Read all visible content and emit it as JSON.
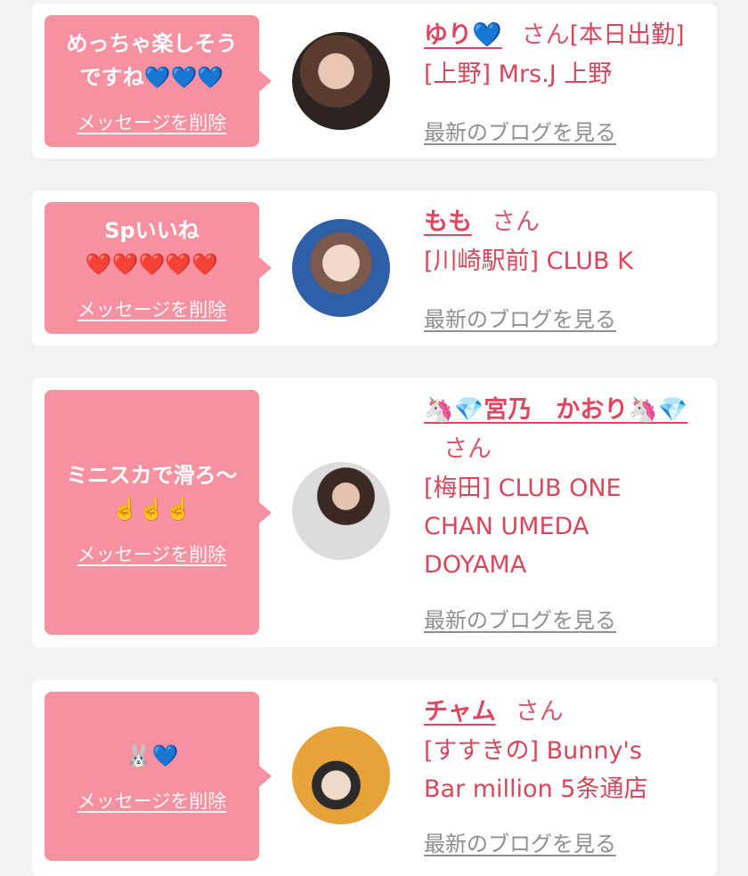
{
  "cards": [
    {
      "message": "めっちゃ楽しそう\nですね💙💙💙",
      "delete_label": "メッセージを削除",
      "name": "ゆり💙",
      "honorific": "さん",
      "status": "[本日出勤]",
      "shop": "[上野] Mrs.J 上野",
      "blog_label": "最新のブログを見る"
    },
    {
      "message": "Spいいね\n❤️❤️❤️❤️❤️",
      "delete_label": "メッセージを削除",
      "name": "もも",
      "honorific": "さん",
      "status": "",
      "shop": "[川崎駅前] CLUB K",
      "blog_label": "最新のブログを見る"
    },
    {
      "message": "ミニスカで滑ろ〜\n☝️☝️☝️",
      "delete_label": "メッセージを削除",
      "name": "🦄💎宮乃　かおり🦄💎",
      "honorific": "さん",
      "status": "",
      "shop": "[梅田] CLUB ONE CHAN UMEDA DOYAMA",
      "blog_label": "最新のブログを見る"
    },
    {
      "message": "🐰💙",
      "delete_label": "メッセージを削除",
      "name": "チャム",
      "honorific": "さん",
      "status": "",
      "shop": "[すすきの] Bunny's Bar million 5条通店",
      "blog_label": "最新のブログを見る"
    }
  ]
}
